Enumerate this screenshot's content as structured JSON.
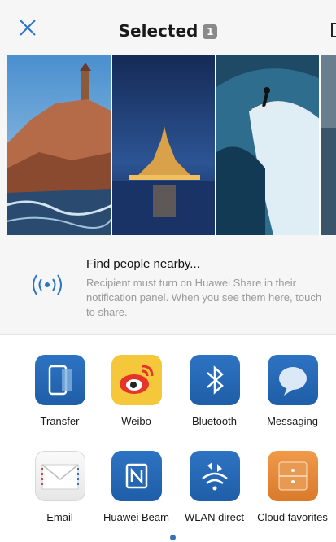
{
  "header": {
    "title": "Selected",
    "count": "1",
    "close_icon": "close-icon"
  },
  "photos": [
    {
      "name": "rocky-coast-lighthouse"
    },
    {
      "name": "mont-saint-michel-night"
    },
    {
      "name": "surfer-wave"
    },
    {
      "name": "partial-photo"
    }
  ],
  "nearby": {
    "icon": "wireless-share-icon",
    "title": "Find people nearby...",
    "description": "Recipient must turn on Huawei Share in their notification panel. When you see them here, touch to share."
  },
  "apps": [
    {
      "label": "Transfer",
      "icon": "transfer-icon"
    },
    {
      "label": "Weibo",
      "icon": "weibo-icon"
    },
    {
      "label": "Bluetooth",
      "icon": "bluetooth-icon"
    },
    {
      "label": "Messaging",
      "icon": "messaging-icon"
    },
    {
      "label": "Email",
      "icon": "email-icon"
    },
    {
      "label": "Huawei Beam",
      "icon": "nfc-beam-icon"
    },
    {
      "label": "WLAN direct",
      "icon": "wlan-direct-icon"
    },
    {
      "label": "Cloud favorites",
      "icon": "cloud-favorites-icon"
    }
  ],
  "colors": {
    "accent": "#2d73c3",
    "header_bg": "#f6f6f6",
    "weibo_bg": "#f4c83a",
    "cloud_bg": "#e08a3a"
  }
}
